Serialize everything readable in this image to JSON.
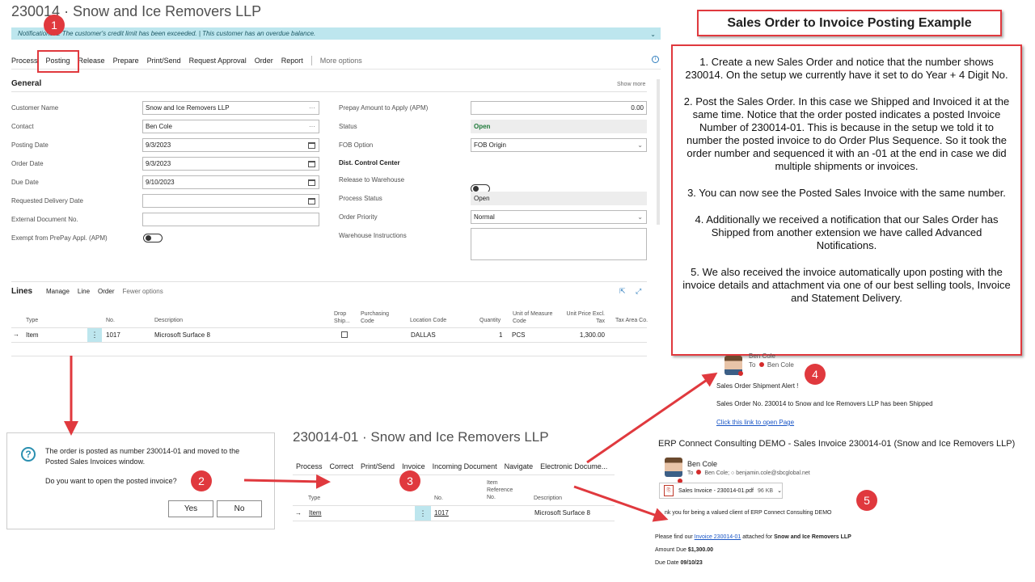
{
  "order_page": {
    "title": "230014 · Snow and Ice Removers LLP",
    "notifications": "Notifications: 2    The customer's credit limit has been exceeded.  |  This customer has an overdue balance.",
    "actions": [
      "Process",
      "Posting",
      "Release",
      "Prepare",
      "Print/Send",
      "Request Approval",
      "Order",
      "Report"
    ],
    "more_options": "More options",
    "general_title": "General",
    "show_more": "Show more",
    "left_fields": [
      {
        "label": "Customer Name",
        "value": "Snow and Ice Removers LLP",
        "icon": "dots"
      },
      {
        "label": "Contact",
        "value": "Ben Cole",
        "icon": "dots"
      },
      {
        "label": "Posting Date",
        "value": "9/3/2023",
        "icon": "calendar"
      },
      {
        "label": "Order Date",
        "value": "9/3/2023",
        "icon": "calendar"
      },
      {
        "label": "Due Date",
        "value": "9/10/2023",
        "icon": "calendar"
      },
      {
        "label": "Requested Delivery Date",
        "value": "",
        "icon": "calendar"
      },
      {
        "label": "External Document No.",
        "value": "",
        "icon": ""
      }
    ],
    "exempt_label": "Exempt from PrePay Appl. (APM)",
    "prepay_label": "Prepay Amount to Apply (APM)",
    "prepay_value": "0.00",
    "status_label": "Status",
    "status_value": "Open",
    "fob_label": "FOB Option",
    "fob_value": "FOB Origin",
    "dist_title": "Dist. Control Center",
    "release_label": "Release to Warehouse",
    "process_status_label": "Process Status",
    "process_status_value": "Open",
    "priority_label": "Order Priority",
    "priority_value": "Normal",
    "warehouse_label": "Warehouse Instructions",
    "lines_title": "Lines",
    "lines_actions": [
      "Manage",
      "Line",
      "Order"
    ],
    "fewer_options": "Fewer options",
    "lines_headers": {
      "type": "Type",
      "no": "No.",
      "desc": "Description",
      "drop": "Drop Ship...",
      "purch": "Purchasing Code",
      "loc": "Location Code",
      "qty": "Quantity",
      "uom": "Unit of Measure Code",
      "price": "Unit Price Excl. Tax",
      "tax": "Tax Area Co..."
    },
    "line": {
      "type": "Item",
      "no": "1017",
      "desc": "Microsoft Surface 8",
      "loc": "DALLAS",
      "qty": "1",
      "uom": "PCS",
      "price": "1,300.00"
    }
  },
  "dialog": {
    "message": "The order is posted as number 230014-01 and moved to the Posted Sales Invoices window.",
    "question": "Do you want to open the posted invoice?",
    "yes": "Yes",
    "no": "No"
  },
  "posted_page": {
    "title": "230014-01 · Snow and Ice Removers LLP",
    "actions": [
      "Process",
      "Correct",
      "Print/Send",
      "Invoice",
      "Incoming Document",
      "Navigate",
      "Electronic Docume..."
    ],
    "headers": {
      "type": "Type",
      "no": "No.",
      "itemref": "Item Reference No.",
      "desc": "Description"
    },
    "line": {
      "type": "Item",
      "no": "1017",
      "desc": "Microsoft Surface 8"
    }
  },
  "example": {
    "title": "Sales Order to Invoice Posting Example",
    "steps": [
      "1. Create a new Sales Order and notice that the number shows 230014. On the setup we currently have it set to do Year + 4 Digit No.",
      "2. Post the Sales Order. In this case we Shipped and Invoiced it at the same time. Notice that the order posted indicates a posted Invoice Number of 230014-01. This is because in the setup we told it to number the posted invoice to do Order Plus Sequence. So it took the order number and sequenced it with an -01 at the end in case we did multiple shipments or invoices.",
      "3. You can now see the Posted Sales Invoice with the same number.",
      "4. Additionally we received a notification that our Sales Order has Shipped from another extension we have called Advanced Notifications.",
      "5. We also received the invoice automatically upon posting with the invoice details and attachment via one of our best selling tools, Invoice and Statement Delivery."
    ]
  },
  "email1": {
    "sender": "Ben Cole",
    "to_label": "To",
    "to_name": "Ben Cole",
    "alert": "Sales Order Shipment Alert !",
    "body": "Sales Order No. 230014 to Snow and Ice Removers LLP has been Shipped",
    "link": "Click this link to open Page"
  },
  "email2": {
    "subject": "ERP Connect Consulting DEMO - Sales Invoice 230014-01 (Snow and Ice Removers LLP)",
    "sender": "Ben Cole",
    "to_label": "To",
    "to_name": "Ben Cole;",
    "to_email": "benjamin.cole@sbcglobal.net",
    "attachment": "Sales Invoice - 230014-01.pdf",
    "attachment_size": "96 KB",
    "thanks": "nk you for being a valued client of ERP Connect Consulting DEMO",
    "find_prefix": "Please find our",
    "invoice_link": "Invoice 230014-01",
    "find_mid": "attached for",
    "customer": "Snow and Ice Removers LLP",
    "amount_label": "Amount Due",
    "amount": "$1,300.00",
    "due_label": "Due Date",
    "due": "09/10/23"
  },
  "badges": [
    "1",
    "2",
    "3",
    "4",
    "5"
  ],
  "colors": {
    "accent_red": "#e0393e",
    "notification_bg": "#bde6ee",
    "status_green": "#1f7a3a",
    "link_blue": "#1a56c6"
  }
}
